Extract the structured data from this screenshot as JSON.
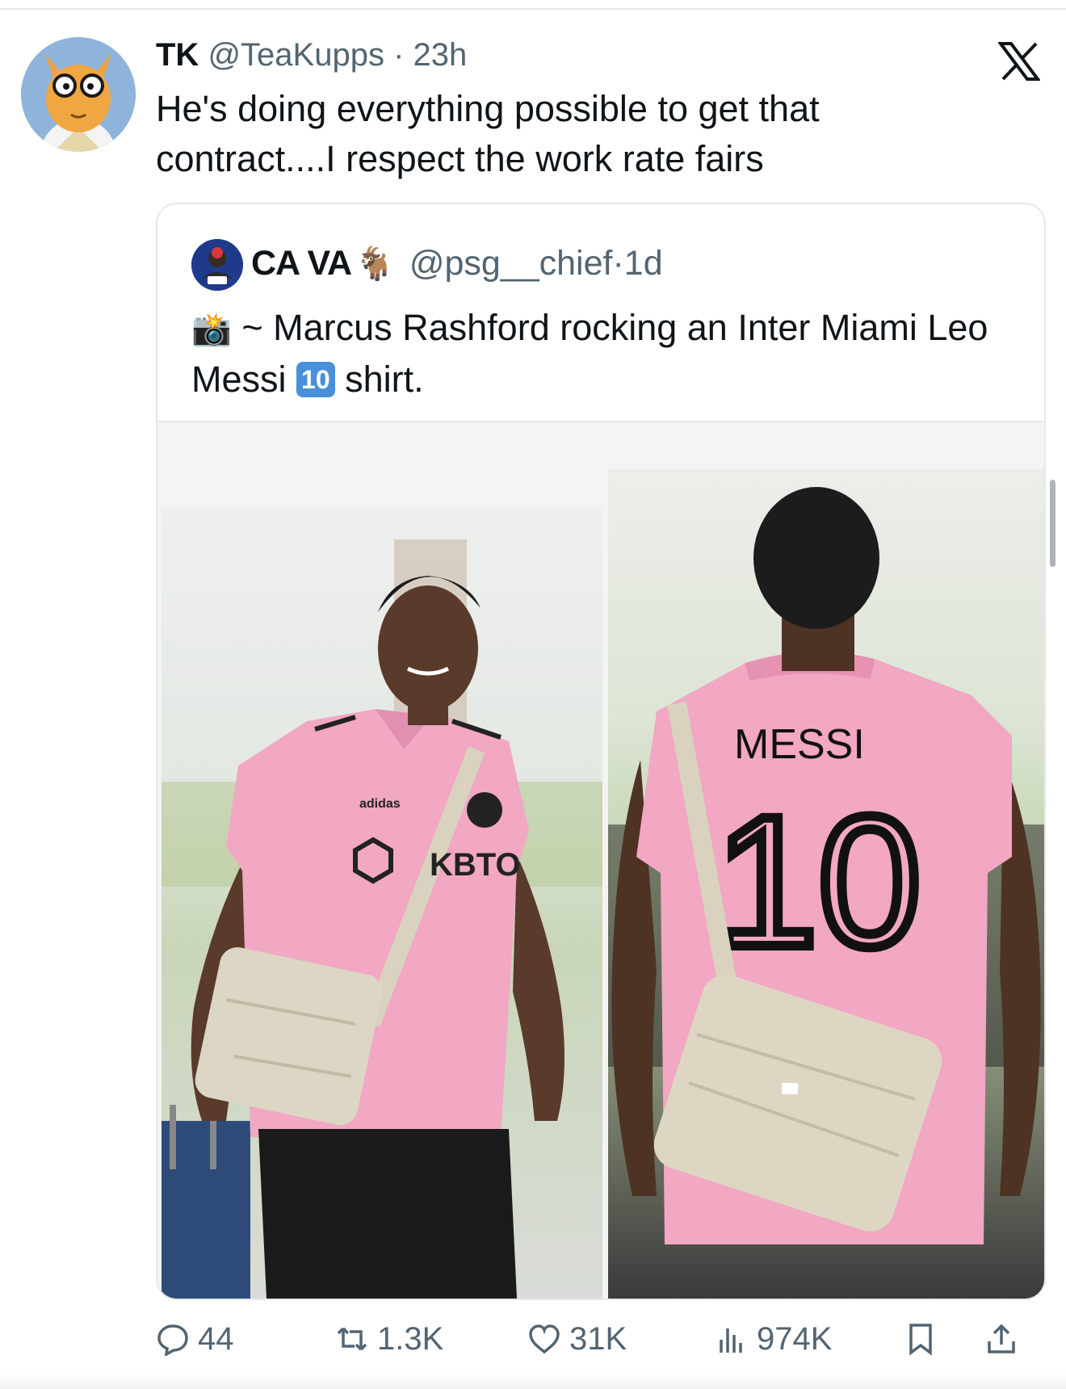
{
  "tweet": {
    "display_name": "TK",
    "handle": "@TeaKupps",
    "separator": "·",
    "age": "23h",
    "text": "He's doing everything possible to get that\ncontract....I respect the work rate fairs",
    "avatar_icon": "cartoon-aardvark-avatar",
    "platform_icon": "x-logo-icon"
  },
  "quoted_tweet": {
    "display_name": "CA VA",
    "name_emoji": "🐐",
    "handle": "@psg__chief",
    "separator": "·",
    "age": "1d",
    "text_lead_emoji": "📸",
    "text_part1": " ~ Marcus Rashford rocking an Inter Miami Leo Messi ",
    "keycap": "10",
    "text_part2": " shirt.",
    "media": {
      "left_photo": {
        "shirt_text": "KBTO",
        "brand_text": "adidas"
      },
      "right_photo": {
        "shirt_name": "MESSI",
        "shirt_number": "10"
      }
    }
  },
  "actions": {
    "replies": "44",
    "reposts": "1.3K",
    "likes": "31K",
    "views": "974K"
  },
  "colors": {
    "text": "#0f1419",
    "muted": "#536471",
    "border": "#e6e9eb",
    "shirt_pink": "#f2a7c3"
  }
}
